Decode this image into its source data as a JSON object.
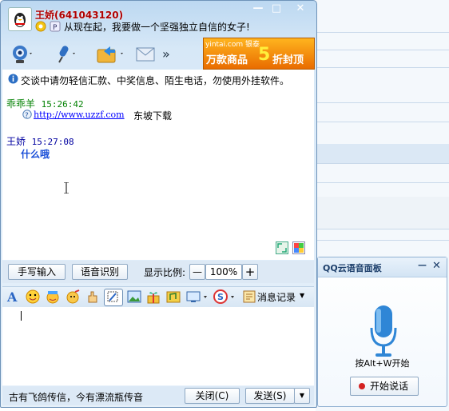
{
  "chat": {
    "contact_title": "王娇(641043120)",
    "signature": "从现在起，我要做一个坚强独立自信的女子!",
    "window_buttons": [
      "—",
      "□",
      "✕"
    ],
    "ad_top": "yintai.com 银泰",
    "ad_main": "万款商品",
    "ad_highlight": "5",
    "ad_tail": "折封顶",
    "more_label": "»",
    "warning": "交谈中请勿轻信汇款、中奖信息、陌生电话，勿使用外挂软件。",
    "messages": [
      {
        "sender": "乖乖羊",
        "time": "15:26:42",
        "link": "http://www.uzzf.com",
        "text": "东坡下载"
      },
      {
        "sender": "王娇",
        "time": "15:27:08",
        "text": "什么哦"
      }
    ],
    "handwrite_label": "手写输入",
    "voice_recog_label": "语音识别",
    "zoom_label": "显示比例:",
    "zoom_minus": "—",
    "zoom_value": "100%",
    "zoom_plus": "+",
    "history_label": "消息记录",
    "input_text": "",
    "status_text": "古有飞鸽传信，今有漂流瓶传音",
    "close_label": "关闭(C)",
    "send_label": "发送(S)",
    "send_arrow": "▼"
  },
  "voice_panel": {
    "title": "QQ云语音面板",
    "minimize": "—",
    "close": "✕",
    "hint": "按Alt+W开始",
    "start_label": "开始说话"
  },
  "icons": [
    "qq-penguin-icon",
    "webcam-icon",
    "microphone-icon",
    "folder-transfer-icon",
    "mail-icon",
    "font-icon",
    "smiley-icon",
    "emoticon-icon",
    "magic-icon",
    "hand-icon",
    "screenshot-icon",
    "picture-icon",
    "gift-icon",
    "music-icon",
    "screen-share-icon",
    "sogou-icon",
    "history-icon",
    "microphone-large-icon"
  ],
  "colors": {
    "accent": "#2e7fd0",
    "title_red": "#b00000",
    "sender_green": "#008000",
    "sender_blue": "#0000a0",
    "reply_blue": "#1a4fd8"
  }
}
